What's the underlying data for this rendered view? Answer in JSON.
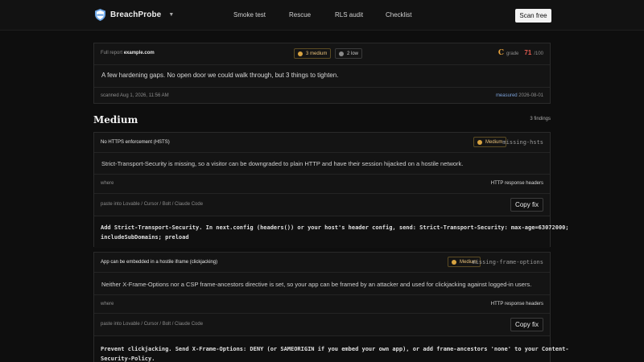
{
  "nav": {
    "brand": "BreachProbe",
    "links": [
      "Smoke test",
      "Rescue",
      "RLS audit",
      "Checklist"
    ],
    "cta": "Scan free"
  },
  "summary": {
    "report_prefix": "Full report",
    "domain": "example.com",
    "medium_badge": "3 medium",
    "low_badge": "2 low",
    "grade_letter": "C",
    "grade_word": "grade",
    "score": "71",
    "score_max": "/100",
    "message": "A few hardening gaps. No open door we could walk through, but 3 things to tighten.",
    "scanned": "scanned Aug 1, 2026, 11:56 AM",
    "measured_label": "measured",
    "measured_date": "2026-08-01"
  },
  "section": {
    "title": "Medium",
    "count": "3 findings"
  },
  "findings": [
    {
      "title": "No HTTPS enforcement (HSTS)",
      "severity": "Medium",
      "code": "missing-hsts",
      "description": "Strict-Transport-Security is missing, so a visitor can be downgraded to plain HTTP and have their session hijacked on a hostile network.",
      "where_label": "where",
      "where_value": "HTTP response headers",
      "paste_label": "paste into Lovable / Cursor / Bolt / Claude Code",
      "copy_label": "Copy fix",
      "fix_line1": "Add Strict-Transport-Security. In next.config (headers()) or your host's header config, send: Strict-Transport-Security: max-age=63072000;",
      "fix_line2": "includeSubDomains; preload"
    },
    {
      "title": "App can be embedded in a hostile iframe (clickjacking)",
      "severity": "Medium",
      "code": "missing-frame-options",
      "description": "Neither X-Frame-Options nor a CSP frame-ancestors directive is set, so your app can be framed by an attacker and used for clickjacking against logged-in users.",
      "where_label": "where",
      "where_value": "HTTP response headers",
      "paste_label": "paste into Lovable / Cursor / Bolt / Claude Code",
      "copy_label": "Copy fix",
      "fix_line1": "Prevent clickjacking. Send X-Frame-Options: DENY (or SAMEORIGIN if you embed your own app), or add frame-ancestors 'none' to your Content-",
      "fix_line2": "Security-Policy."
    }
  ],
  "colors": {
    "accent_orange": "#e8a33c",
    "score_red": "#e05a4e",
    "medium_dot": "#d9a441",
    "low_dot": "#8a8a8a"
  }
}
